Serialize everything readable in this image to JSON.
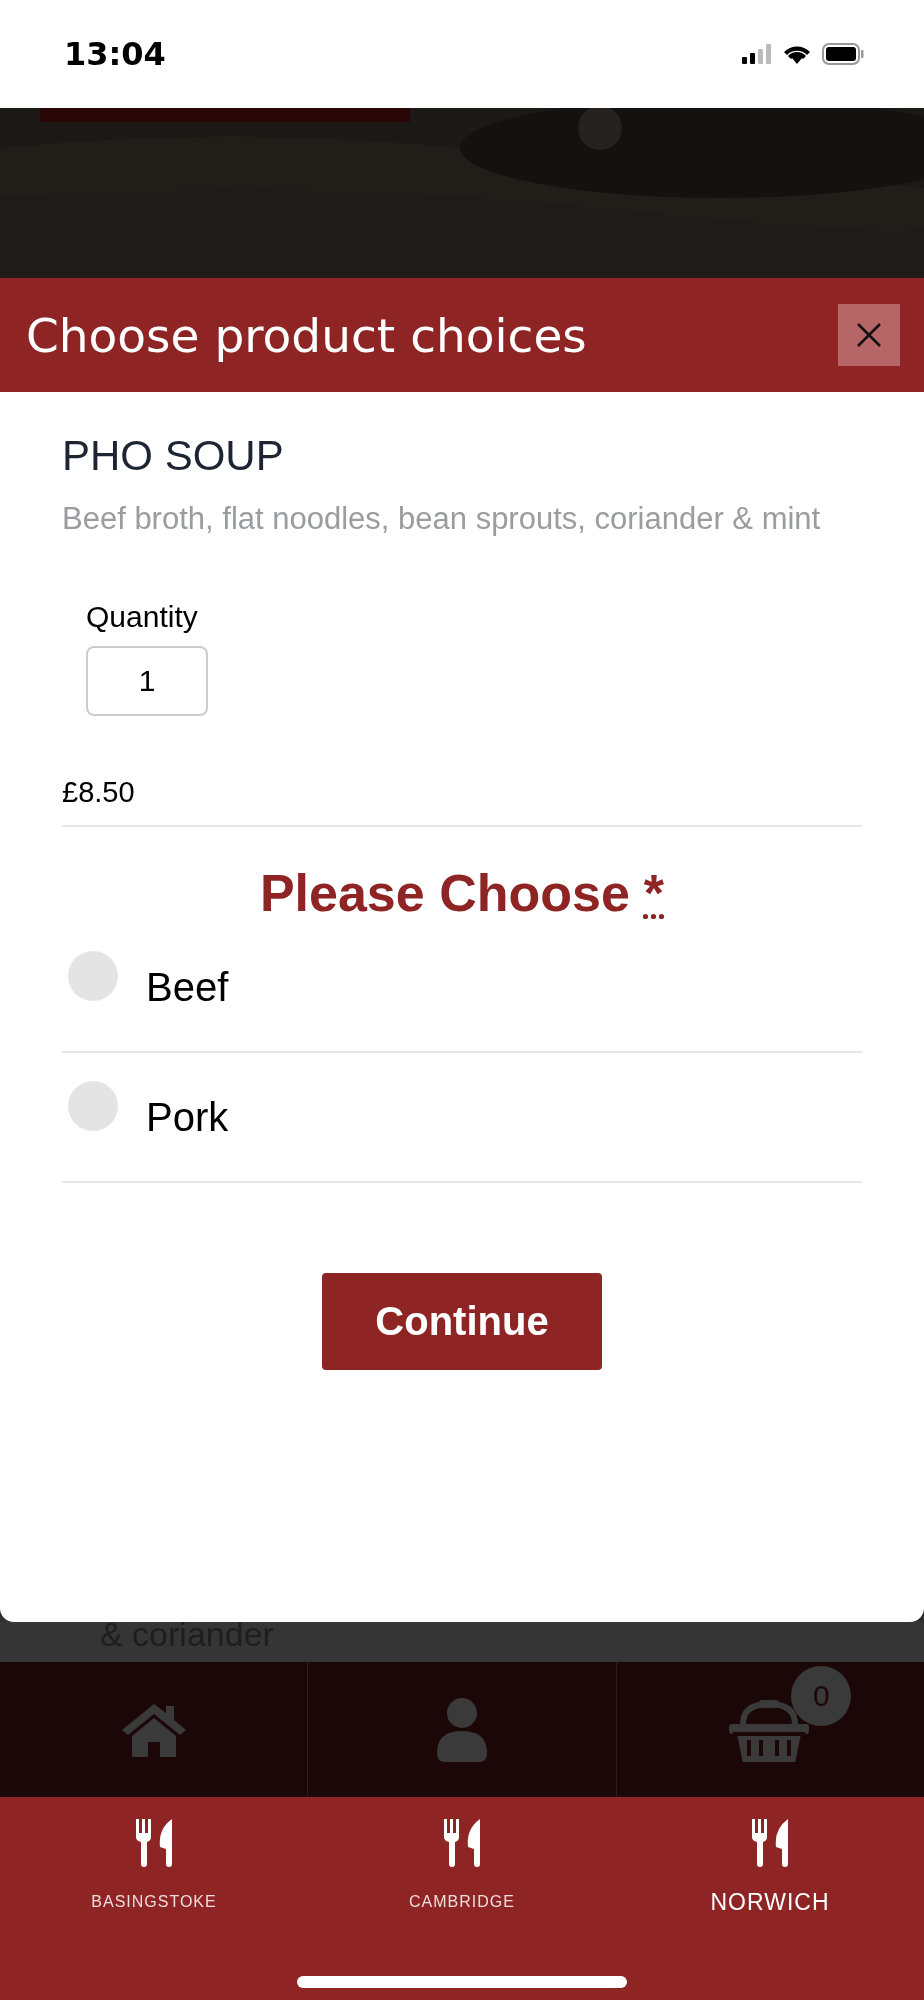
{
  "status_bar": {
    "time": "13:04"
  },
  "background_text": "& coriander",
  "modal": {
    "title": "Choose product choices",
    "product": {
      "name": "PHO SOUP",
      "description": "Beef broth, flat noodles, bean sprouts, coriander & mint"
    },
    "quantity": {
      "label": "Quantity",
      "value": "1"
    },
    "price": "£8.50",
    "choice": {
      "heading": "Please Choose",
      "required_mark": "*",
      "options": [
        {
          "label": "Beef",
          "selected": false
        },
        {
          "label": "Pork",
          "selected": false
        }
      ]
    },
    "button": "Continue"
  },
  "nav": {
    "items": [
      {
        "kind": "home"
      },
      {
        "kind": "account"
      },
      {
        "kind": "basket",
        "badge": "0"
      }
    ]
  },
  "locations": [
    {
      "label": "BASINGSTOKE",
      "selected": false
    },
    {
      "label": "CAMBRIDGE",
      "selected": false
    },
    {
      "label": "NORWICH",
      "selected": true
    }
  ]
}
